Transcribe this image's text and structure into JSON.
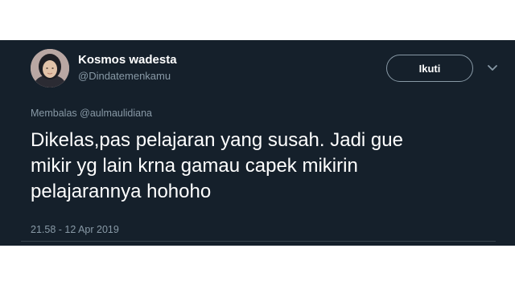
{
  "tweet": {
    "author_name": "Kosmos wadesta",
    "author_handle": "@Dindatemenkamu",
    "follow_label": "Ikuti",
    "reply_prefix": "Membalas",
    "reply_to": "@aulmaulidiana",
    "text": "Dikelas,pas pelajaran yang susah. Jadi gue\nmikir yg lain krna gamau capek mikirin\npelajarannya hohoho",
    "timestamp": "21.58 - 12 Apr 2019"
  },
  "icons": {
    "avatar": "profile-photo",
    "menu": "chevron-down-icon"
  },
  "colors": {
    "background": "#15202b",
    "primary_text": "#ffffff",
    "secondary_text": "#8899a6",
    "border": "#38444d"
  }
}
